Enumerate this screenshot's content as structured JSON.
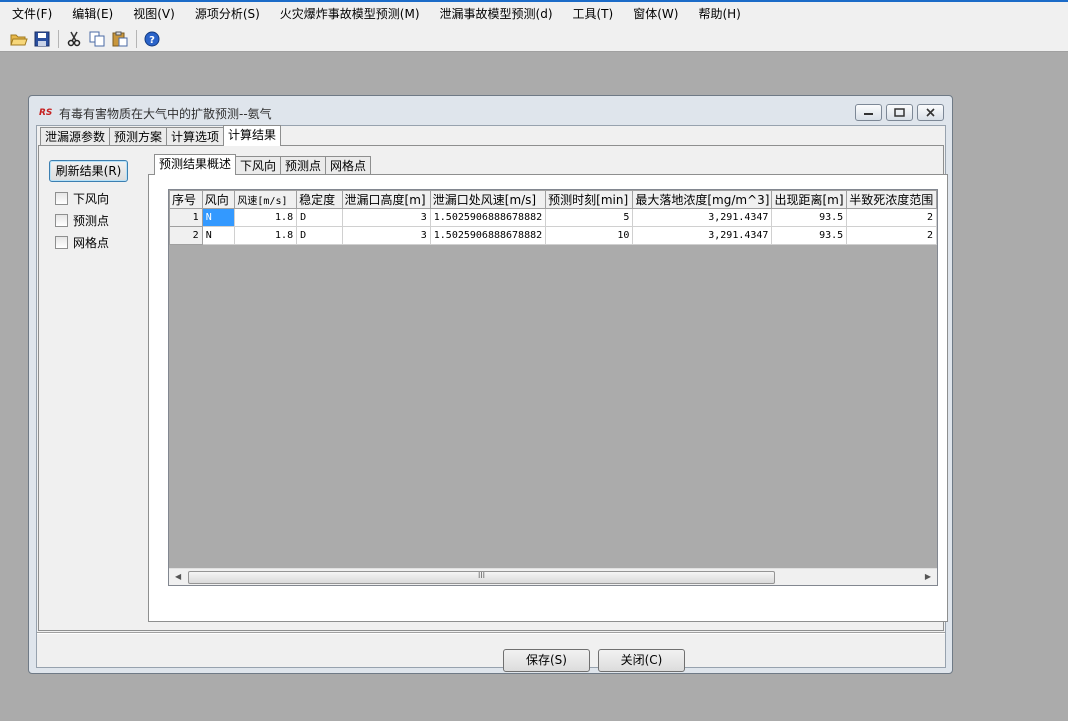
{
  "menu": {
    "items": [
      "文件(F)",
      "编辑(E)",
      "视图(V)",
      "源项分析(S)",
      "火灾爆炸事故模型预测(M)",
      "泄漏事故模型预测(d)",
      "工具(T)",
      "窗体(W)",
      "帮助(H)"
    ]
  },
  "toolbar": {
    "icons": [
      "open-folder-icon",
      "save-disk-icon",
      "cut-scissors-icon",
      "copy-icon",
      "paste-icon",
      "help-icon"
    ]
  },
  "window": {
    "title": "有毒有害物质在大气中的扩散预测--氨气",
    "tabs": [
      "泄漏源参数",
      "预测方案",
      "计算选项",
      "计算结果"
    ],
    "refresh_label": "刷新结果(R)",
    "checkboxes": [
      "下风向",
      "预测点",
      "网格点"
    ],
    "subtabs": [
      "预测结果概述",
      "下风向",
      "预测点",
      "网格点"
    ],
    "save_label": "保存(S)",
    "close_label": "关闭(C)"
  },
  "table": {
    "columns": [
      "序号",
      "风向",
      "风速[m/s]",
      "稳定度",
      "泄漏口高度[m]",
      "泄漏口处风速[m/s]",
      "预测时刻[min]",
      "最大落地浓度[mg/m^3]",
      "出现距离[m]",
      "半致死浓度范围"
    ],
    "rows": [
      [
        "1",
        "N",
        "1.8",
        "D",
        "3",
        "1.5025906888678882",
        "5",
        "3,291.4347",
        "93.5",
        "2"
      ],
      [
        "2",
        "N",
        "1.8",
        "D",
        "3",
        "1.5025906888678882",
        "10",
        "3,291.4347",
        "93.5",
        "2"
      ]
    ],
    "scroll_grip": "III"
  }
}
